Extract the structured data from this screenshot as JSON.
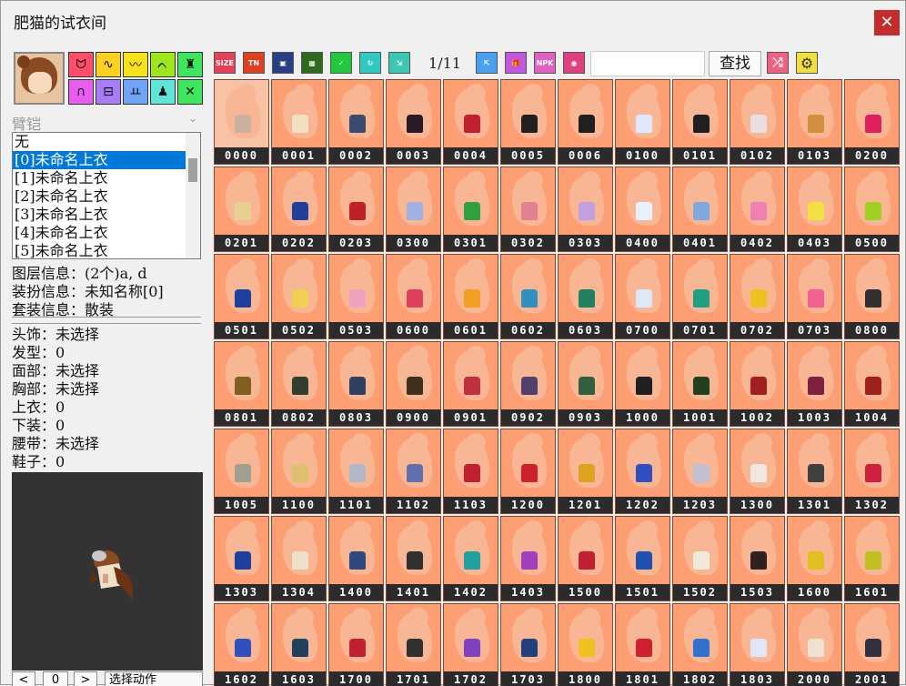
{
  "window": {
    "title": "肥猫的试衣间",
    "close_label": "✕"
  },
  "left": {
    "category_icons": [
      {
        "name": "headwear",
        "color": "#ff4d6a",
        "glyph": "ᗢ"
      },
      {
        "name": "hair",
        "color": "#ffd21f",
        "glyph": "∿"
      },
      {
        "name": "face",
        "color": "#f5e21a",
        "glyph": "〰"
      },
      {
        "name": "wing",
        "color": "#9ee61b",
        "glyph": "ᨈ"
      },
      {
        "name": "crown",
        "color": "#3de65c",
        "glyph": "♜"
      },
      {
        "name": "pants",
        "color": "#e95cf0",
        "glyph": "∩"
      },
      {
        "name": "belt",
        "color": "#a77cf5",
        "glyph": "⊟"
      },
      {
        "name": "shoes",
        "color": "#6fa3f5",
        "glyph": "ㅛ"
      },
      {
        "name": "body",
        "color": "#5fe6d9",
        "glyph": "♟"
      },
      {
        "name": "weapon",
        "color": "#3de65c",
        "glyph": "✕"
      }
    ],
    "slot_select": "臂铠",
    "list_items": [
      "无",
      "[0]未命名上衣",
      "[1]未命名上衣",
      "[2]未命名上衣",
      "[3]未命名上衣",
      "[4]未命名上衣",
      "[5]未命名上衣"
    ],
    "selected_index": 1,
    "info_lines": [
      "图层信息：(2个)a, d",
      "装扮信息：未知名称[0]",
      "套装信息：散装"
    ],
    "stat_lines": [
      "头饰：未选择",
      "发型：0",
      "面部：未选择",
      "胸部：未选择",
      "上衣：0",
      "下装：0",
      "腰带：未选择",
      "鞋子：0"
    ],
    "bottom": {
      "prev": "<",
      "frame": "0",
      "next": ">",
      "action": "选择动作"
    }
  },
  "toolbar": {
    "buttons": [
      {
        "name": "size",
        "label": "SIZE",
        "color": "#e8405a"
      },
      {
        "name": "tn",
        "label": "TN",
        "color": "#e04020"
      },
      {
        "name": "frame",
        "label": "▣",
        "color": "#2a3e86"
      },
      {
        "name": "film",
        "label": "▦",
        "color": "#2e6a1e"
      },
      {
        "name": "shirt",
        "label": "✓",
        "color": "#22c83c"
      },
      {
        "name": "refresh",
        "label": "↻",
        "color": "#30c8c0"
      },
      {
        "name": "export",
        "label": "⇲",
        "color": "#3cc7b4"
      }
    ],
    "page": "1/11",
    "buttons2": [
      {
        "name": "import",
        "label": "⇱",
        "color": "#4aa0f0"
      },
      {
        "name": "gift",
        "label": "🎁",
        "color": "#c058e0"
      },
      {
        "name": "npk",
        "label": "NPK",
        "color": "#e060c0"
      },
      {
        "name": "globe",
        "label": "◉",
        "color": "#e04080"
      }
    ],
    "search_placeholder": "",
    "find_label": "查找",
    "shuffle_label": "⤮",
    "settings_label": "⚙"
  },
  "grid": {
    "items": [
      {
        "code": "0000",
        "color": "#c9b0a0"
      },
      {
        "code": "0001",
        "color": "#f3e0c0"
      },
      {
        "code": "0002",
        "color": "#3a4a70"
      },
      {
        "code": "0003",
        "color": "#2a1a2a"
      },
      {
        "code": "0004",
        "color": "#c02030"
      },
      {
        "code": "0005",
        "color": "#202020"
      },
      {
        "code": "0006",
        "color": "#202020"
      },
      {
        "code": "0100",
        "color": "#e0e8ff"
      },
      {
        "code": "0101",
        "color": "#202020"
      },
      {
        "code": "0102",
        "color": "#e8e0e0"
      },
      {
        "code": "0103",
        "color": "#d09040"
      },
      {
        "code": "0200",
        "color": "#e02060"
      },
      {
        "code": "0201",
        "color": "#e8d090"
      },
      {
        "code": "0202",
        "color": "#2040a0"
      },
      {
        "code": "0203",
        "color": "#c02028"
      },
      {
        "code": "0300",
        "color": "#a0b0e0"
      },
      {
        "code": "0301",
        "color": "#30a040"
      },
      {
        "code": "0302",
        "color": "#e08090"
      },
      {
        "code": "0303",
        "color": "#c0a0e0"
      },
      {
        "code": "0400",
        "color": "#e8f0ff"
      },
      {
        "code": "0401",
        "color": "#80a8e0"
      },
      {
        "code": "0402",
        "color": "#f080b0"
      },
      {
        "code": "0403",
        "color": "#f0e040"
      },
      {
        "code": "0500",
        "color": "#a0d020"
      },
      {
        "code": "0501",
        "color": "#2040a0"
      },
      {
        "code": "0502",
        "color": "#f0d050"
      },
      {
        "code": "0503",
        "color": "#f0a0c0"
      },
      {
        "code": "0600",
        "color": "#e04060"
      },
      {
        "code": "0601",
        "color": "#f0a020"
      },
      {
        "code": "0602",
        "color": "#3090c0"
      },
      {
        "code": "0603",
        "color": "#208060"
      },
      {
        "code": "0700",
        "color": "#e0e8f8"
      },
      {
        "code": "0701",
        "color": "#20a080"
      },
      {
        "code": "0702",
        "color": "#f0c020"
      },
      {
        "code": "0703",
        "color": "#f06090"
      },
      {
        "code": "0800",
        "color": "#303030"
      },
      {
        "code": "0801",
        "color": "#806020"
      },
      {
        "code": "0802",
        "color": "#304030"
      },
      {
        "code": "0803",
        "color": "#304060"
      },
      {
        "code": "0900",
        "color": "#403020"
      },
      {
        "code": "0901",
        "color": "#c03040"
      },
      {
        "code": "0902",
        "color": "#504070"
      },
      {
        "code": "0903",
        "color": "#306040"
      },
      {
        "code": "1000",
        "color": "#202020"
      },
      {
        "code": "1001",
        "color": "#204020"
      },
      {
        "code": "1002",
        "color": "#a02020"
      },
      {
        "code": "1003",
        "color": "#802040"
      },
      {
        "code": "1004",
        "color": "#a02020"
      },
      {
        "code": "1005",
        "color": "#a0a090"
      },
      {
        "code": "1100",
        "color": "#e0c070"
      },
      {
        "code": "1101",
        "color": "#b0b8c8"
      },
      {
        "code": "1102",
        "color": "#6070b0"
      },
      {
        "code": "1103",
        "color": "#c02030"
      },
      {
        "code": "1200",
        "color": "#d02030"
      },
      {
        "code": "1201",
        "color": "#e0a020"
      },
      {
        "code": "1202",
        "color": "#3050c0"
      },
      {
        "code": "1203",
        "color": "#c0c0d0"
      },
      {
        "code": "1300",
        "color": "#f0e8e0"
      },
      {
        "code": "1301",
        "color": "#404040"
      },
      {
        "code": "1302",
        "color": "#d02040"
      },
      {
        "code": "1303",
        "color": "#2040a0"
      },
      {
        "code": "1304",
        "color": "#f0e0c8"
      },
      {
        "code": "1400",
        "color": "#304880"
      },
      {
        "code": "1401",
        "color": "#303030"
      },
      {
        "code": "1402",
        "color": "#20a0a0"
      },
      {
        "code": "1403",
        "color": "#a040c0"
      },
      {
        "code": "1500",
        "color": "#c02030"
      },
      {
        "code": "1501",
        "color": "#2050b0"
      },
      {
        "code": "1502",
        "color": "#f0e8d8"
      },
      {
        "code": "1503",
        "color": "#302020"
      },
      {
        "code": "1600",
        "color": "#e0c020"
      },
      {
        "code": "1601",
        "color": "#c0c020"
      },
      {
        "code": "1602",
        "color": "#3050c0"
      },
      {
        "code": "1603",
        "color": "#204060"
      },
      {
        "code": "1700",
        "color": "#c02030"
      },
      {
        "code": "1701",
        "color": "#303030"
      },
      {
        "code": "1702",
        "color": "#8040c0"
      },
      {
        "code": "1703",
        "color": "#204080"
      },
      {
        "code": "1800",
        "color": "#f0c020"
      },
      {
        "code": "1801",
        "color": "#d02030"
      },
      {
        "code": "1802",
        "color": "#3070d0"
      },
      {
        "code": "1803",
        "color": "#e0e8f8"
      },
      {
        "code": "2000",
        "color": "#f0e0d0"
      },
      {
        "code": "2001",
        "color": "#303040"
      }
    ]
  }
}
